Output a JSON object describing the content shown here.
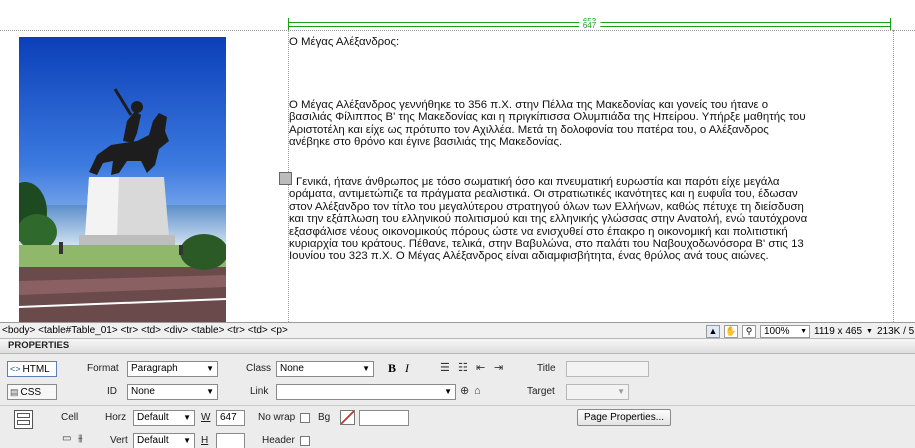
{
  "canvas": {
    "rulers": {
      "outer": "653",
      "inner": "647"
    },
    "photo_alt": "Alexander the Great statue",
    "heading": "Ο Μέγας Αλέξανδρος:",
    "para1_lines": [
      "Ο Μέγας Αλέξανδρος γεννήθηκε το 356 π.Χ. στην Πέλλα της Μακεδονίας και γονείς του ήτανε ο",
      "βασιλιάς Φίλιππος Β' της Μακεδονίας και η πριγκίπισσα Ολυμπιάδα της Ηπείρου. Υπήρξε μαθητής του",
      "Αριστοτέλη και είχε ως πρότυπο τον Αχιλλέα. Μετά τη δολοφονία του πατέρα του, ο Αλέξανδρος",
      "ανέβηκε στο θρόνο και έγινε βασιλιάς της Μακεδονίας."
    ],
    "para2_lines": [
      "Γενικά, ήτανε άνθρωπος με τόσο σωματική όσο και πνευματική ευρωστία και παρότι είχε μεγάλα",
      "οράματα, αντιμετώπιζε τα πράγματα ρεαλιστικά. Οι στρατιωτικές ικανότητες και η ευφυΐα του, έδωσαν",
      "στον Αλέξανδρο τον τίτλο του μεγαλύτερου στρατηγού όλων των Ελλήνων, καθώς πέτυχε τη διείσδυση",
      "και την εξάπλωση του ελληνικού πολιτισμού και της ελληνικής γλώσσας στην Ανατολή, ενώ ταυτόχρονα",
      "εξασφάλισε νέους οικονομικούς πόρους ώστε να ενισχυθεί στο έπακρο η οικονομική και πολιτιστική",
      "κυριαρχία του κράτους. Πέθανε, τελικά, στην Βαβυλώνα, στο παλάτι του Ναβουχοδωνόσορα Β' στις 13",
      "Ιουνίου του 323 π.Χ. Ο Μέγας Αλέξανδρος είναι αδιαμφισβήτητα, ένας θρύλος ανά τους αιώνες."
    ]
  },
  "tagbar": {
    "path": "<body> <table#Table_01> <tr> <td> <div> <table> <tr> <td> <p>",
    "zoom": "100%",
    "size": "1119 x 465",
    "weight": "213K / 5"
  },
  "properties": {
    "header": "PROPERTIES",
    "html_mode": "HTML",
    "css_mode": "CSS",
    "format_label": "Format",
    "format_value": "Paragraph",
    "id_label": "ID",
    "id_value": "None",
    "class_label": "Class",
    "class_value": "None",
    "link_label": "Link",
    "link_value": "",
    "bold": "B",
    "italic": "I",
    "title_label": "Title",
    "title_value": "",
    "target_label": "Target",
    "target_value": "",
    "cell_label": "Cell",
    "horz_label": "Horz",
    "horz_value": "Default",
    "vert_label": "Vert",
    "vert_value": "Default",
    "w_label": "W",
    "w_value": "647",
    "h_label": "H",
    "h_value": "",
    "nowrap_label": "No wrap",
    "bg_label": "Bg",
    "header_label": "Header",
    "page_properties": "Page Properties..."
  }
}
